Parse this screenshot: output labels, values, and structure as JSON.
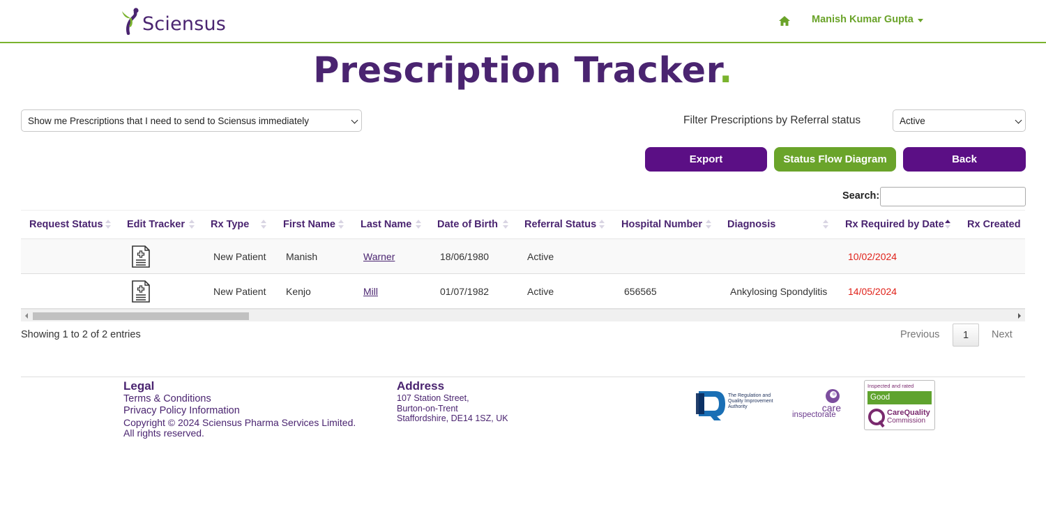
{
  "header": {
    "brand": "Sciensus",
    "home_icon": "home-icon",
    "user_name": "Manish Kumar Gupta"
  },
  "page": {
    "title": "Prescription Tracker",
    "title_dot": "."
  },
  "controls": {
    "view_select": "Show me Prescriptions that I need to send to Sciensus immediately",
    "filter_label": "Filter Prescriptions by Referral status",
    "status_select": "Active",
    "export_label": "Export",
    "flow_label": "Status Flow Diagram",
    "back_label": "Back",
    "search_label": "Search:",
    "search_value": ""
  },
  "table": {
    "columns": [
      "Request Status",
      "Edit Tracker",
      "Rx Type",
      "First Name",
      "Last Name",
      "Date of Birth",
      "Referral Status",
      "Hospital Number",
      "Diagnosis",
      "Rx Required by Date",
      "Rx Created"
    ],
    "rows": [
      {
        "request_status": "",
        "rx_type": "New Patient",
        "first_name": "Manish",
        "last_name": "Warner",
        "dob": "18/06/1980",
        "referral_status": "Active",
        "hospital_number": "",
        "diagnosis": "",
        "rx_required": "10/02/2024",
        "rx_created": ""
      },
      {
        "request_status": "",
        "rx_type": "New Patient",
        "first_name": "Kenjo",
        "last_name": "Mill",
        "dob": "01/07/1982",
        "referral_status": "Active",
        "hospital_number": "656565",
        "diagnosis": "Ankylosing Spondylitis",
        "rx_required": "14/05/2024",
        "rx_created": ""
      }
    ],
    "info": "Showing 1 to 2 of 2 entries",
    "pagination": {
      "previous": "Previous",
      "current": "1",
      "next": "Next"
    }
  },
  "footer": {
    "legal_heading": "Legal",
    "terms": "Terms & Conditions",
    "privacy": "Privacy Policy Information",
    "copyright": "Copyright © 2024 Sciensus Pharma Services Limited.",
    "rights": "All rights reserved.",
    "address_heading": "Address",
    "address_lines": [
      "107 Station Street,",
      "Burton-on-Trent",
      "Staffordshire, DE14 1SZ, UK"
    ],
    "rqia_text": [
      "The Regulation and",
      "Quality Improvement",
      "Authority"
    ],
    "care_text": [
      "care",
      "inspectorate"
    ],
    "cqc_rated": "Inspected and rated",
    "cqc_rating": "Good",
    "cqc_name": [
      "CareQuality",
      "Commission"
    ]
  },
  "colors": {
    "brand_purple": "#4a2470",
    "button_purple": "#5b0f85",
    "brand_green": "#7ab32e",
    "date_red": "#e0221a"
  }
}
